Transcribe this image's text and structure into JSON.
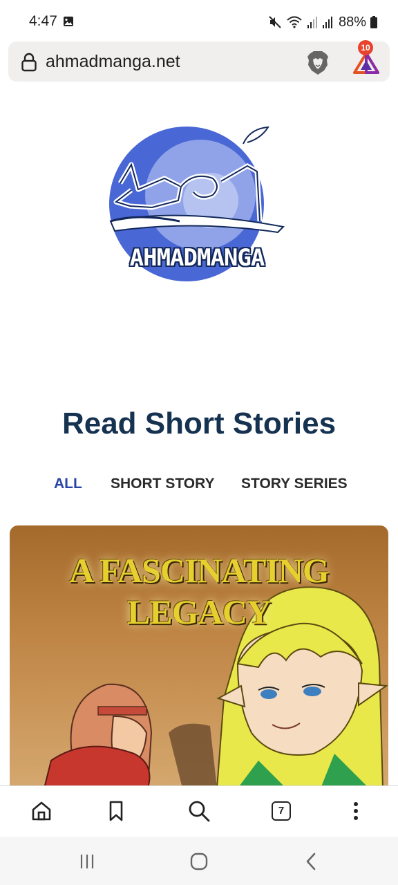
{
  "status_bar": {
    "time": "4:47",
    "battery": "88%"
  },
  "address_bar": {
    "url": "ahmadmanga.net",
    "rewards_count": "10"
  },
  "logo": {
    "wordmark": "AHMADMANGA"
  },
  "main": {
    "title": "Read Short Stories",
    "filters": [
      {
        "label": "ALL",
        "active": true
      },
      {
        "label": "SHORT STORY",
        "active": false
      },
      {
        "label": "STORY SERIES",
        "active": false
      }
    ],
    "story_card": {
      "title_line1": "A FASCINATING",
      "title_line2": "LEGACY"
    }
  },
  "toolbar": {
    "tab_count": "7"
  },
  "colors": {
    "title": "#163251",
    "active_filter": "#2945a8",
    "logo_blue": "#4a67d6"
  }
}
